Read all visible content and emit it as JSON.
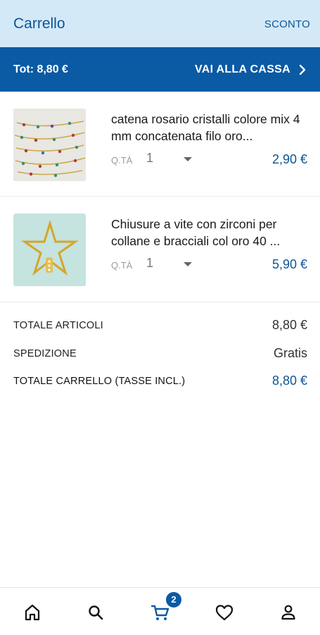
{
  "header": {
    "title": "Carrello",
    "discount_label": "SCONTO"
  },
  "checkout_bar": {
    "total": "Tot: 8,80 €",
    "checkout_label": "VAI ALLA CASSA"
  },
  "items": [
    {
      "name": "catena rosario cristalli colore mix 4 mm concatenata filo oro...",
      "qty_label": "Q.TÀ",
      "qty": "1",
      "price": "2,90 €"
    },
    {
      "name": "Chiusure a vite con zirconi per collane e bracciali col oro  40 ...",
      "qty_label": "Q.TÀ",
      "qty": "1",
      "price": "5,90 €"
    }
  ],
  "summary": {
    "articles_label": "TOTALE ARTICOLI",
    "articles_value": "8,80 €",
    "shipping_label": "SPEDIZIONE",
    "shipping_value": "Gratis",
    "cart_total_label": "TOTALE CARRELLO (TASSE INCL.)",
    "cart_total_value": "8,80 €"
  },
  "bottom_nav": {
    "items": [
      "home-icon",
      "search-icon",
      "cart-icon",
      "heart-icon",
      "user-icon"
    ],
    "cart_badge": "2"
  },
  "colors": {
    "primary": "#0b5aa4",
    "header_bg": "#d4e9f7",
    "accent_text": "#0b5596"
  }
}
